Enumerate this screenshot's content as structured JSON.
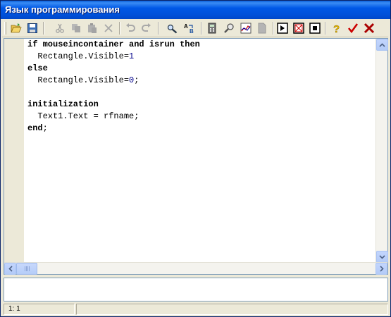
{
  "window": {
    "title": "Язык программирования"
  },
  "toolbar": {
    "buttons": [
      {
        "name": "open",
        "icon": "open-folder-icon"
      },
      {
        "name": "save",
        "icon": "save-disk-icon"
      },
      {
        "name": "cut",
        "icon": "scissors-icon",
        "disabled": true
      },
      {
        "name": "copy",
        "icon": "copy-icon",
        "disabled": true
      },
      {
        "name": "paste",
        "icon": "paste-icon",
        "disabled": true
      },
      {
        "name": "delete",
        "icon": "delete-x-icon",
        "disabled": true
      },
      {
        "name": "undo",
        "icon": "undo-icon",
        "disabled": true
      },
      {
        "name": "redo",
        "icon": "redo-icon",
        "disabled": true
      },
      {
        "name": "find",
        "icon": "find-binoculars-icon"
      },
      {
        "name": "replace",
        "icon": "replace-ab-icon"
      },
      {
        "name": "calculator",
        "icon": "calculator-icon"
      },
      {
        "name": "inspect",
        "icon": "magnifier-icon"
      },
      {
        "name": "chart",
        "icon": "chart-icon"
      },
      {
        "name": "page",
        "icon": "page-icon",
        "disabled": true
      },
      {
        "name": "run",
        "icon": "play-icon"
      },
      {
        "name": "frame",
        "icon": "frame-icon"
      },
      {
        "name": "stop",
        "icon": "stop-icon"
      },
      {
        "name": "help",
        "icon": "question-icon"
      },
      {
        "name": "ok",
        "icon": "checkmark-icon"
      },
      {
        "name": "cancel",
        "icon": "red-x-icon"
      }
    ]
  },
  "editor": {
    "lines": [
      "if mouseincontainer and isrun then",
      "  Rectangle.Visible=1",
      "else",
      "  Rectangle.Visible=0;",
      "",
      "initialization",
      "  Text1.Text = rfname;",
      "end;"
    ],
    "keywords": [
      "if",
      "and",
      "then",
      "else",
      "initialization",
      "end"
    ]
  },
  "statusbar": {
    "position": "1: 1"
  },
  "colors": {
    "titlebar": "#0054e3",
    "toolbar_bg": "#ece9d8",
    "number": "#00008b",
    "ok_check": "#cc0000",
    "cancel_x": "#aa0000"
  }
}
